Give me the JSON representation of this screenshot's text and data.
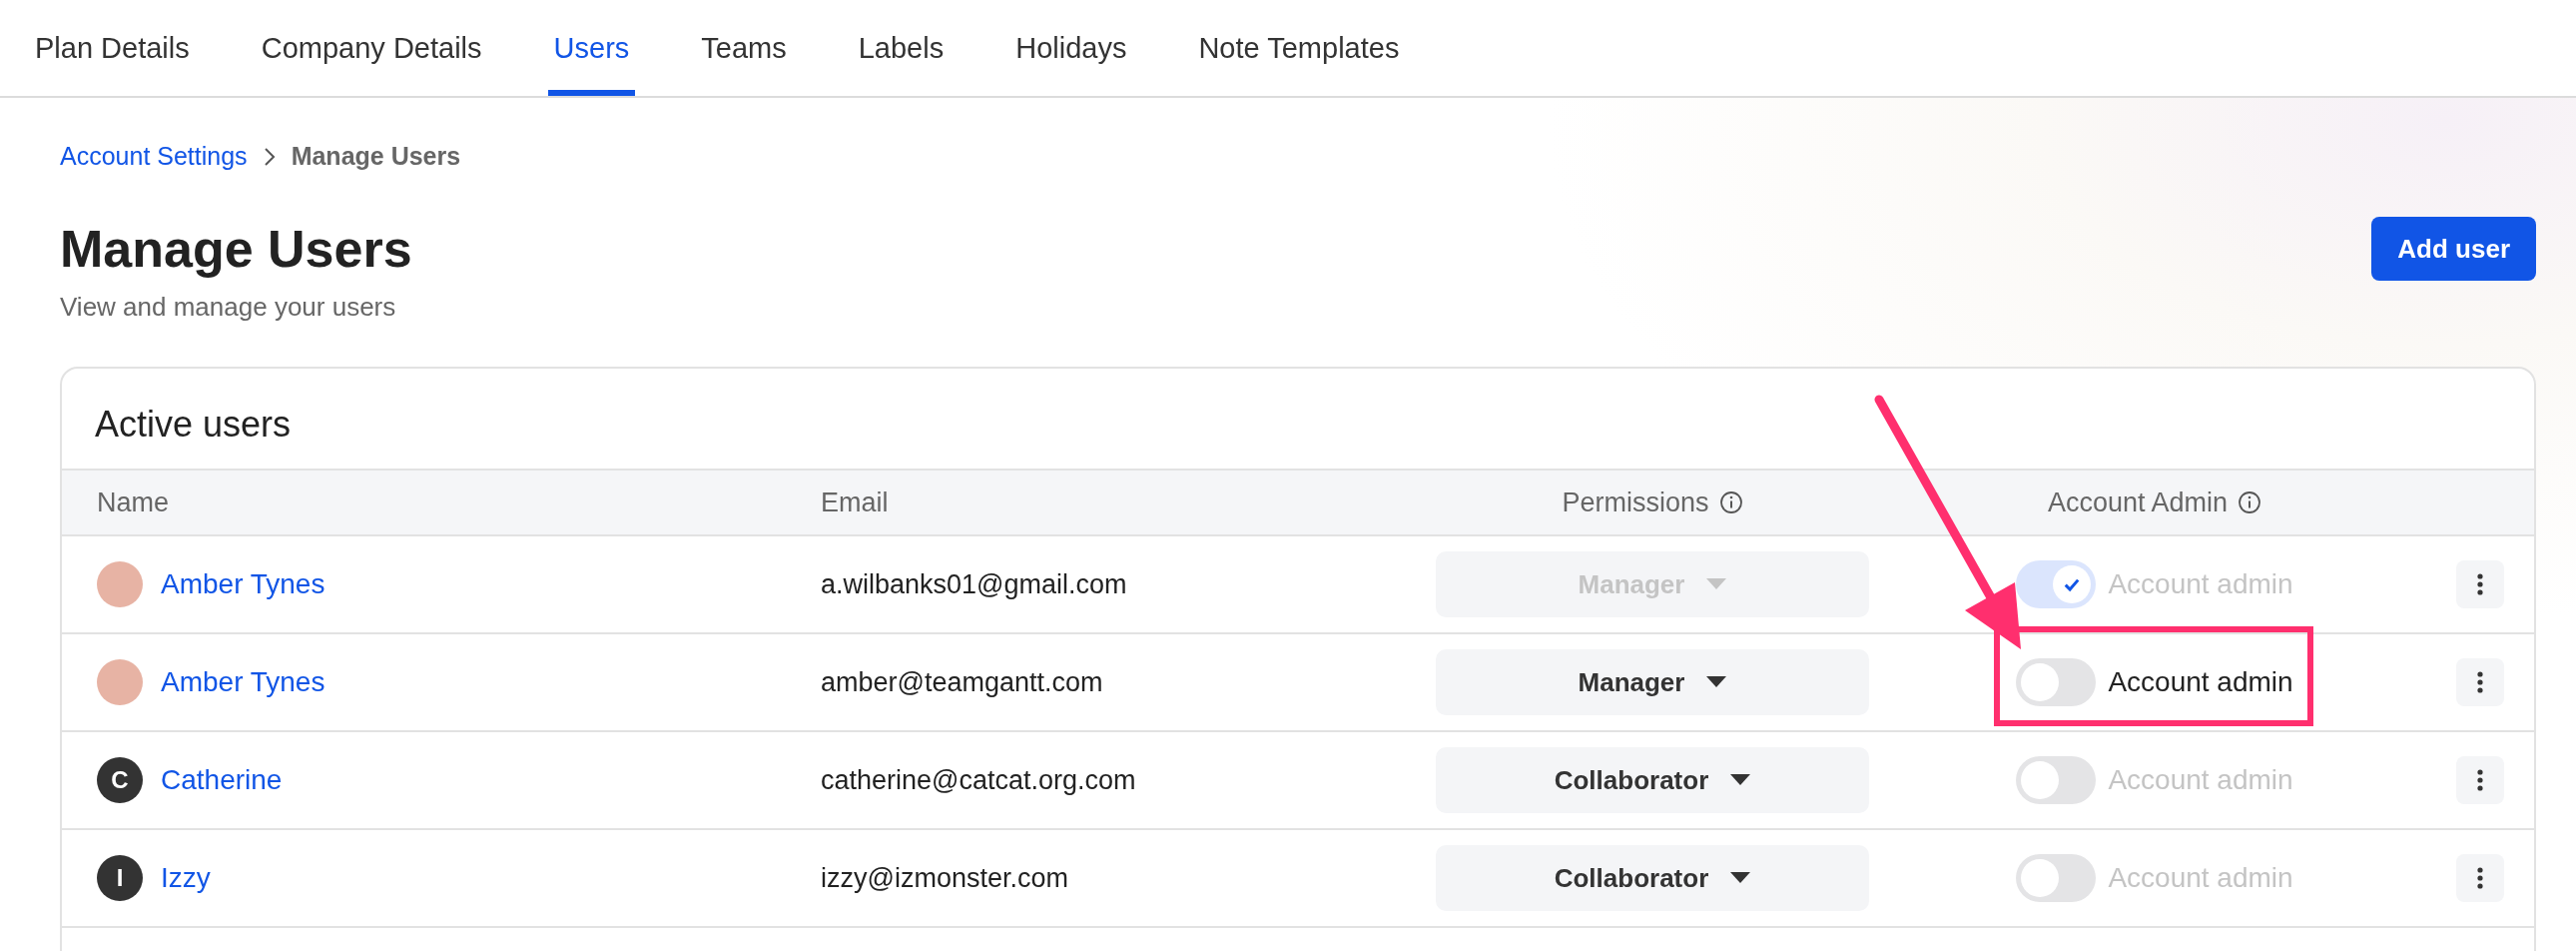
{
  "tabs": [
    {
      "label": "Plan Details",
      "selected": false
    },
    {
      "label": "Company Details",
      "selected": false
    },
    {
      "label": "Users",
      "selected": true
    },
    {
      "label": "Teams",
      "selected": false
    },
    {
      "label": "Labels",
      "selected": false
    },
    {
      "label": "Holidays",
      "selected": false
    },
    {
      "label": "Note Templates",
      "selected": false
    }
  ],
  "breadcrumb": {
    "link": "Account Settings",
    "current": "Manage Users"
  },
  "title": "Manage Users",
  "subtitle": "View and manage your users",
  "add_button": "Add user",
  "card": {
    "title": "Active users",
    "columns": [
      {
        "label": "Name",
        "info": false
      },
      {
        "label": "Email",
        "info": false
      },
      {
        "label": "Permissions",
        "info": true
      },
      {
        "label": "Account Admin",
        "info": true
      }
    ],
    "rows": [
      {
        "avatar": {
          "kind": "photo"
        },
        "name": "Amber Tynes",
        "email": "a.wilbanks01@gmail.com",
        "permission": "Manager",
        "permission_disabled": true,
        "admin": true,
        "admin_disabled": true,
        "admin_label": "Account admin"
      },
      {
        "avatar": {
          "kind": "photo"
        },
        "name": "Amber Tynes",
        "email": "amber@teamgantt.com",
        "permission": "Manager",
        "permission_disabled": false,
        "admin": false,
        "admin_disabled": false,
        "admin_label": "Account admin"
      },
      {
        "avatar": {
          "kind": "initial",
          "letter": "C"
        },
        "name": "Catherine",
        "email": "catherine@catcat.org.com",
        "permission": "Collaborator",
        "permission_disabled": false,
        "admin": false,
        "admin_disabled": true,
        "admin_label": "Account admin"
      },
      {
        "avatar": {
          "kind": "initial",
          "letter": "I"
        },
        "name": "Izzy",
        "email": "izzy@izmonster.com",
        "permission": "Collaborator",
        "permission_disabled": false,
        "admin": false,
        "admin_disabled": true,
        "admin_label": "Account admin"
      }
    ]
  }
}
